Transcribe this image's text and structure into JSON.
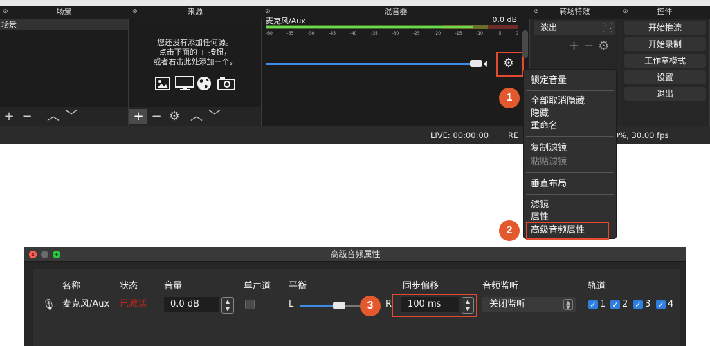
{
  "docks": {
    "scenes": {
      "title": "场景",
      "items": [
        "场景"
      ]
    },
    "sources": {
      "title": "来源",
      "empty_message": [
        "您还没有添加任何源。",
        "点击下面的 + 按钮，",
        "或者右击此处添加一个。"
      ]
    },
    "mixer": {
      "title": "混音器",
      "channel": {
        "name": "麦克风/Aux",
        "db": "0.0 dB",
        "ticks": [
          "-60",
          "-55",
          "-50",
          "-45",
          "-40",
          "-35",
          "-30",
          "-25",
          "-20",
          "-15",
          "-10",
          "-5",
          "0"
        ]
      }
    },
    "transitions": {
      "title": "转场特效",
      "selected": "淡出"
    },
    "controls": {
      "title": "控件",
      "buttons": [
        "开始推流",
        "开始录制",
        "工作室模式",
        "设置",
        "退出"
      ]
    }
  },
  "status": {
    "live": "LIVE: 00:00:00",
    "rec": "RE",
    "cpu": "9%, 30.00 fps"
  },
  "context_menu": {
    "items": [
      {
        "label": "锁定音量",
        "enabled": true
      },
      {
        "label": "全部取消隐藏",
        "enabled": true
      },
      {
        "label": "隐藏",
        "enabled": true
      },
      {
        "label": "重命名",
        "enabled": true
      },
      {
        "label": "复制滤镜",
        "enabled": true
      },
      {
        "label": "粘贴滤镜",
        "enabled": false
      },
      {
        "label": "垂直布局",
        "enabled": true
      },
      {
        "label": "滤镜",
        "enabled": true
      },
      {
        "label": "属性",
        "enabled": true
      },
      {
        "label": "高级音频属性",
        "enabled": true
      }
    ]
  },
  "badges": [
    "1",
    "2",
    "3"
  ],
  "advanced_audio": {
    "window_title": "高级音频属性",
    "headers": {
      "name": "名称",
      "status": "状态",
      "volume": "音量",
      "mono": "单声道",
      "balance": "平衡",
      "sync_offset": "同步偏移",
      "monitoring": "音频监听",
      "tracks": "轨道"
    },
    "row": {
      "name": "麦克风/Aux",
      "status": "已激活",
      "volume": "0.0 dB",
      "mono": false,
      "balance_left": "L",
      "balance_right": "R",
      "balance_value": 0.5,
      "sync_offset": "100 ms",
      "monitoring": "关闭监听",
      "tracks": [
        "1",
        "2",
        "3",
        "4"
      ]
    }
  },
  "colors": {
    "accent": "#e4582e",
    "highlight_border": "#e34a2f",
    "checkbox": "#2f7fe0",
    "slider": "#3c8ce6",
    "status_inactive": "#c1241c"
  }
}
